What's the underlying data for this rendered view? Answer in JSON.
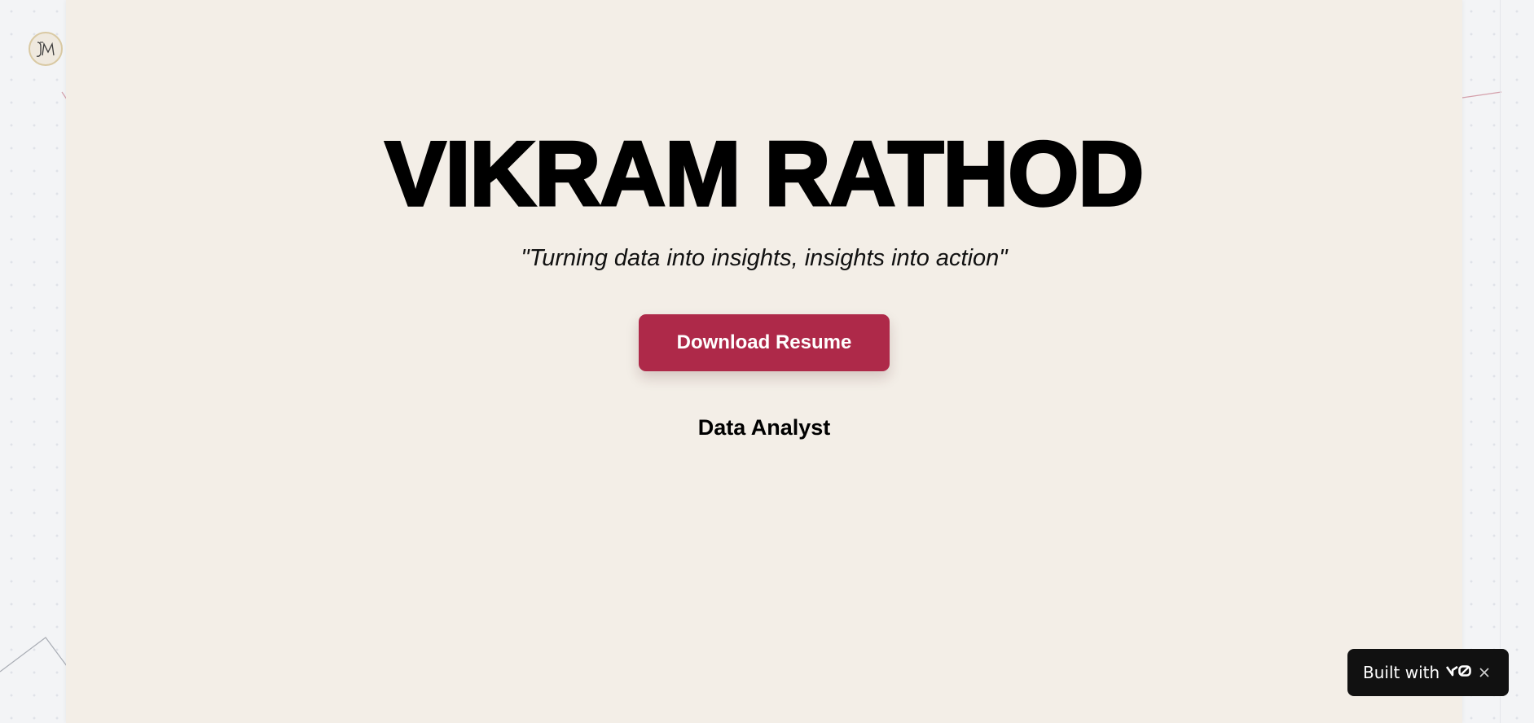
{
  "hero": {
    "name": "VIKRAM RATHOD",
    "tagline": "\"Turning data into insights, insights into action\"",
    "download_button_label": "Download Resume",
    "role": "Data Analyst"
  },
  "logo": {
    "icon": "jm-monogram-logo",
    "monogram": "JM"
  },
  "built_with_badge": {
    "label": "Built with",
    "brand_icon": "v0-logo",
    "close_icon": "close-icon"
  },
  "colors": {
    "page_background": "#f3f4f6",
    "panel_background": "#f3eee7",
    "accent": "#ae2949",
    "badge_background": "#111111",
    "text": "#000000"
  }
}
